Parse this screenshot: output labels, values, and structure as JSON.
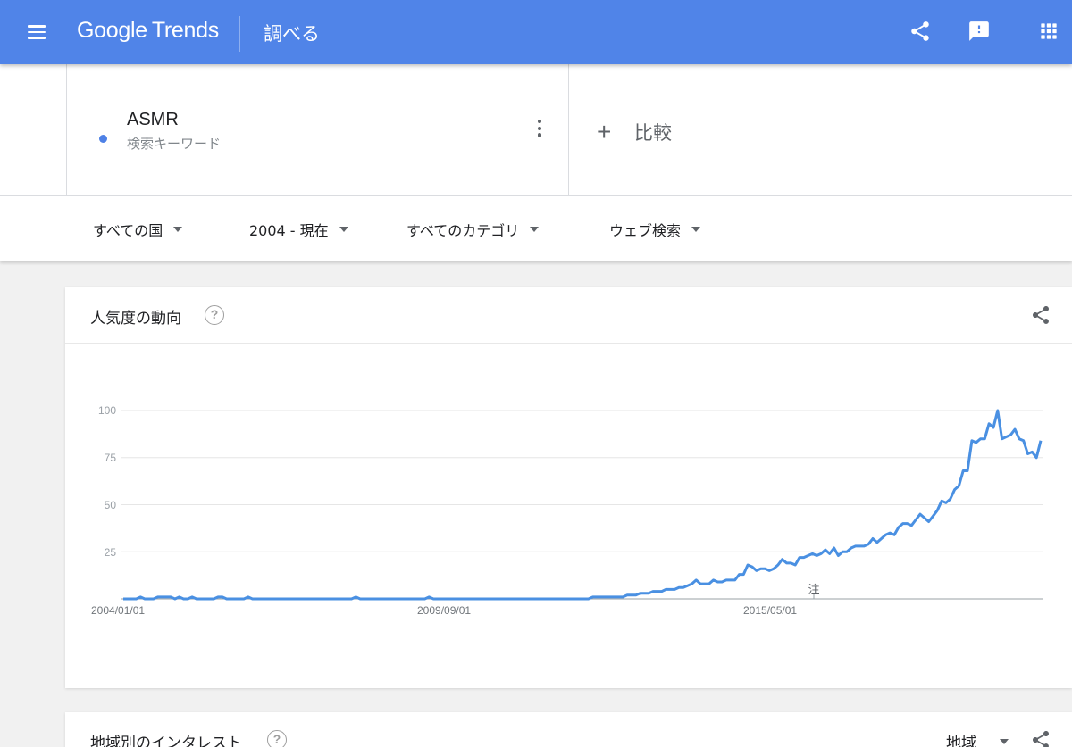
{
  "header": {
    "logo_google": "Google",
    "logo_trends": "Trends",
    "page_title": "調べる",
    "bg_color": "#5084e8"
  },
  "search_term": {
    "name": "ASMR",
    "type_label": "検索キーワード",
    "dot_color": "#4e81e6"
  },
  "compare": {
    "icon": "+",
    "label": "比較"
  },
  "filters": [
    {
      "label": "すべての国"
    },
    {
      "label": "2004 - 現在"
    },
    {
      "label": "すべてのカテゴリ"
    },
    {
      "label": "ウェブ検索"
    }
  ],
  "interest_card": {
    "title": "人気度の動向",
    "help": "?",
    "note_marker": "注"
  },
  "region_card": {
    "title": "地域別のインタレスト",
    "help": "?",
    "select_label": "地域"
  },
  "chart_data": {
    "type": "line",
    "ylim": [
      0,
      100
    ],
    "y_ticks": [
      "100",
      "75",
      "50",
      "25"
    ],
    "x_tick_labels": [
      "2004/01/01",
      "2009/09/01",
      "2015/05/01"
    ],
    "series_color": "#4a90e2",
    "x_start": "2004-01",
    "x_end": "2018-09",
    "values": [
      0,
      0,
      0,
      0,
      1,
      0,
      0,
      0,
      1,
      1,
      1,
      1,
      0,
      1,
      0,
      0,
      1,
      0,
      0,
      0,
      0,
      0,
      1,
      1,
      0,
      0,
      0,
      0,
      0,
      1,
      0,
      0,
      0,
      0,
      0,
      0,
      0,
      0,
      0,
      0,
      0,
      0,
      0,
      0,
      0,
      0,
      0,
      0,
      0,
      0,
      0,
      0,
      0,
      0,
      1,
      0,
      0,
      0,
      0,
      0,
      0,
      0,
      0,
      0,
      0,
      0,
      0,
      0,
      0,
      0,
      0,
      1,
      0,
      0,
      0,
      0,
      0,
      0,
      0,
      0,
      0,
      0,
      0,
      0,
      0,
      0,
      0,
      0,
      0,
      0,
      0,
      0,
      0,
      0,
      0,
      0,
      0,
      0,
      0,
      0,
      0,
      0,
      0,
      0,
      0,
      0,
      0,
      0,
      0,
      1,
      1,
      1,
      1,
      1,
      1,
      1,
      1,
      2,
      2,
      2,
      3,
      3,
      3,
      4,
      4,
      4,
      5,
      5,
      5,
      6,
      6,
      7,
      8,
      10,
      8,
      8,
      8,
      10,
      9,
      9,
      10,
      10,
      10,
      13,
      13,
      18,
      17,
      15,
      16,
      16,
      15,
      16,
      18,
      21,
      19,
      19,
      18,
      22,
      22,
      23,
      24,
      23,
      24,
      26,
      24,
      27,
      23,
      25,
      25,
      27,
      28,
      28,
      28,
      29,
      32,
      30,
      32,
      34,
      35,
      34,
      38,
      40,
      40,
      39,
      42,
      45,
      43,
      41,
      44,
      47,
      52,
      51,
      53,
      58,
      60,
      68,
      68,
      84,
      83,
      85,
      85,
      93,
      91,
      100,
      85,
      86,
      87,
      90,
      85,
      84,
      77,
      78,
      75,
      84
    ]
  }
}
